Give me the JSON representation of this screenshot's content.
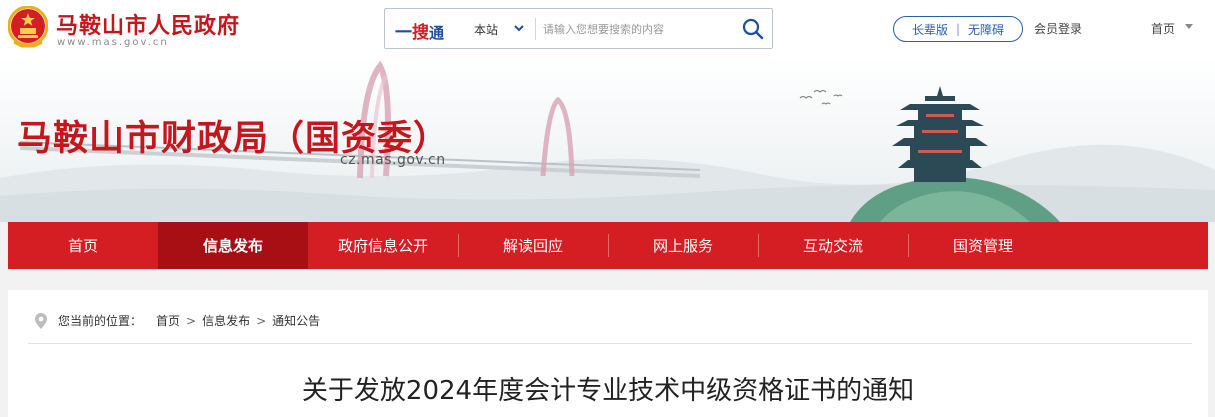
{
  "header": {
    "site_name": "马鞍山市人民政府",
    "site_url": "www.mas.gov.cn",
    "search": {
      "brand_first": "一",
      "brand_second": "搜",
      "brand_third": "通",
      "scope": "本站",
      "placeholder": "请输入您想要搜索的内容",
      "value": ""
    },
    "accessibility": {
      "elder_label": "长辈版",
      "separator": "|",
      "barrier_free_label": "无障碍"
    },
    "login_label": "会员登录",
    "home_label": "首页"
  },
  "banner": {
    "title": "马鞍山市财政局（国资委）",
    "url": "cz.mas.gov.cn"
  },
  "nav": {
    "items": [
      {
        "label": "首页",
        "active": false
      },
      {
        "label": "信息发布",
        "active": true
      },
      {
        "label": "政府信息公开",
        "active": false
      },
      {
        "label": "解读回应",
        "active": false
      },
      {
        "label": "网上服务",
        "active": false
      },
      {
        "label": "互动交流",
        "active": false
      },
      {
        "label": "国资管理",
        "active": false
      }
    ]
  },
  "breadcrumb": {
    "prefix": "您当前的位置：",
    "items": [
      "首页",
      "信息发布",
      "通知公告"
    ],
    "separator": ">"
  },
  "article": {
    "title": "关于发放2024年度会计专业技术中级资格证书的通知"
  },
  "icons": {
    "emblem": "national-emblem-icon",
    "search": "search-icon",
    "scope_caret": "chevron-down-icon",
    "home_caret": "caret-down-icon",
    "location": "location-pin-icon"
  },
  "colors": {
    "brand_red": "#c4161c",
    "nav_red": "#d51d24",
    "nav_active": "#a80f15",
    "search_blue": "#1e4f9c",
    "pill_blue": "#2c5ea8"
  }
}
